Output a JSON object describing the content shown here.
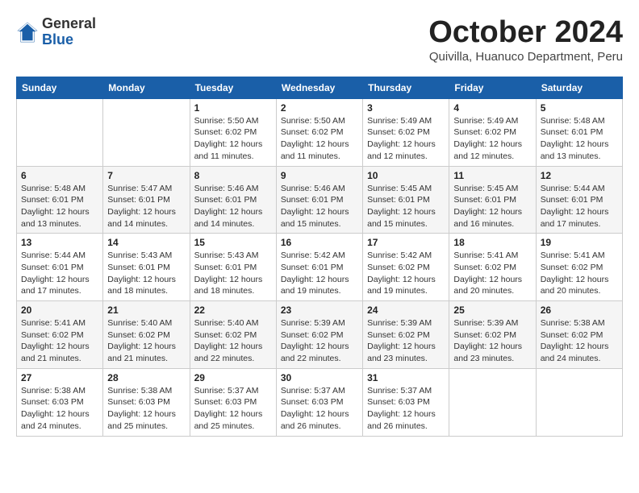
{
  "logo": {
    "general": "General",
    "blue": "Blue"
  },
  "title": "October 2024",
  "subtitle": "Quivilla, Huanuco Department, Peru",
  "days_of_week": [
    "Sunday",
    "Monday",
    "Tuesday",
    "Wednesday",
    "Thursday",
    "Friday",
    "Saturday"
  ],
  "weeks": [
    [
      {
        "day": "",
        "detail": ""
      },
      {
        "day": "",
        "detail": ""
      },
      {
        "day": "1",
        "detail": "Sunrise: 5:50 AM\nSunset: 6:02 PM\nDaylight: 12 hours\nand 11 minutes."
      },
      {
        "day": "2",
        "detail": "Sunrise: 5:50 AM\nSunset: 6:02 PM\nDaylight: 12 hours\nand 11 minutes."
      },
      {
        "day": "3",
        "detail": "Sunrise: 5:49 AM\nSunset: 6:02 PM\nDaylight: 12 hours\nand 12 minutes."
      },
      {
        "day": "4",
        "detail": "Sunrise: 5:49 AM\nSunset: 6:02 PM\nDaylight: 12 hours\nand 12 minutes."
      },
      {
        "day": "5",
        "detail": "Sunrise: 5:48 AM\nSunset: 6:01 PM\nDaylight: 12 hours\nand 13 minutes."
      }
    ],
    [
      {
        "day": "6",
        "detail": "Sunrise: 5:48 AM\nSunset: 6:01 PM\nDaylight: 12 hours\nand 13 minutes."
      },
      {
        "day": "7",
        "detail": "Sunrise: 5:47 AM\nSunset: 6:01 PM\nDaylight: 12 hours\nand 14 minutes."
      },
      {
        "day": "8",
        "detail": "Sunrise: 5:46 AM\nSunset: 6:01 PM\nDaylight: 12 hours\nand 14 minutes."
      },
      {
        "day": "9",
        "detail": "Sunrise: 5:46 AM\nSunset: 6:01 PM\nDaylight: 12 hours\nand 15 minutes."
      },
      {
        "day": "10",
        "detail": "Sunrise: 5:45 AM\nSunset: 6:01 PM\nDaylight: 12 hours\nand 15 minutes."
      },
      {
        "day": "11",
        "detail": "Sunrise: 5:45 AM\nSunset: 6:01 PM\nDaylight: 12 hours\nand 16 minutes."
      },
      {
        "day": "12",
        "detail": "Sunrise: 5:44 AM\nSunset: 6:01 PM\nDaylight: 12 hours\nand 17 minutes."
      }
    ],
    [
      {
        "day": "13",
        "detail": "Sunrise: 5:44 AM\nSunset: 6:01 PM\nDaylight: 12 hours\nand 17 minutes."
      },
      {
        "day": "14",
        "detail": "Sunrise: 5:43 AM\nSunset: 6:01 PM\nDaylight: 12 hours\nand 18 minutes."
      },
      {
        "day": "15",
        "detail": "Sunrise: 5:43 AM\nSunset: 6:01 PM\nDaylight: 12 hours\nand 18 minutes."
      },
      {
        "day": "16",
        "detail": "Sunrise: 5:42 AM\nSunset: 6:01 PM\nDaylight: 12 hours\nand 19 minutes."
      },
      {
        "day": "17",
        "detail": "Sunrise: 5:42 AM\nSunset: 6:02 PM\nDaylight: 12 hours\nand 19 minutes."
      },
      {
        "day": "18",
        "detail": "Sunrise: 5:41 AM\nSunset: 6:02 PM\nDaylight: 12 hours\nand 20 minutes."
      },
      {
        "day": "19",
        "detail": "Sunrise: 5:41 AM\nSunset: 6:02 PM\nDaylight: 12 hours\nand 20 minutes."
      }
    ],
    [
      {
        "day": "20",
        "detail": "Sunrise: 5:41 AM\nSunset: 6:02 PM\nDaylight: 12 hours\nand 21 minutes."
      },
      {
        "day": "21",
        "detail": "Sunrise: 5:40 AM\nSunset: 6:02 PM\nDaylight: 12 hours\nand 21 minutes."
      },
      {
        "day": "22",
        "detail": "Sunrise: 5:40 AM\nSunset: 6:02 PM\nDaylight: 12 hours\nand 22 minutes."
      },
      {
        "day": "23",
        "detail": "Sunrise: 5:39 AM\nSunset: 6:02 PM\nDaylight: 12 hours\nand 22 minutes."
      },
      {
        "day": "24",
        "detail": "Sunrise: 5:39 AM\nSunset: 6:02 PM\nDaylight: 12 hours\nand 23 minutes."
      },
      {
        "day": "25",
        "detail": "Sunrise: 5:39 AM\nSunset: 6:02 PM\nDaylight: 12 hours\nand 23 minutes."
      },
      {
        "day": "26",
        "detail": "Sunrise: 5:38 AM\nSunset: 6:02 PM\nDaylight: 12 hours\nand 24 minutes."
      }
    ],
    [
      {
        "day": "27",
        "detail": "Sunrise: 5:38 AM\nSunset: 6:03 PM\nDaylight: 12 hours\nand 24 minutes."
      },
      {
        "day": "28",
        "detail": "Sunrise: 5:38 AM\nSunset: 6:03 PM\nDaylight: 12 hours\nand 25 minutes."
      },
      {
        "day": "29",
        "detail": "Sunrise: 5:37 AM\nSunset: 6:03 PM\nDaylight: 12 hours\nand 25 minutes."
      },
      {
        "day": "30",
        "detail": "Sunrise: 5:37 AM\nSunset: 6:03 PM\nDaylight: 12 hours\nand 26 minutes."
      },
      {
        "day": "31",
        "detail": "Sunrise: 5:37 AM\nSunset: 6:03 PM\nDaylight: 12 hours\nand 26 minutes."
      },
      {
        "day": "",
        "detail": ""
      },
      {
        "day": "",
        "detail": ""
      }
    ]
  ]
}
